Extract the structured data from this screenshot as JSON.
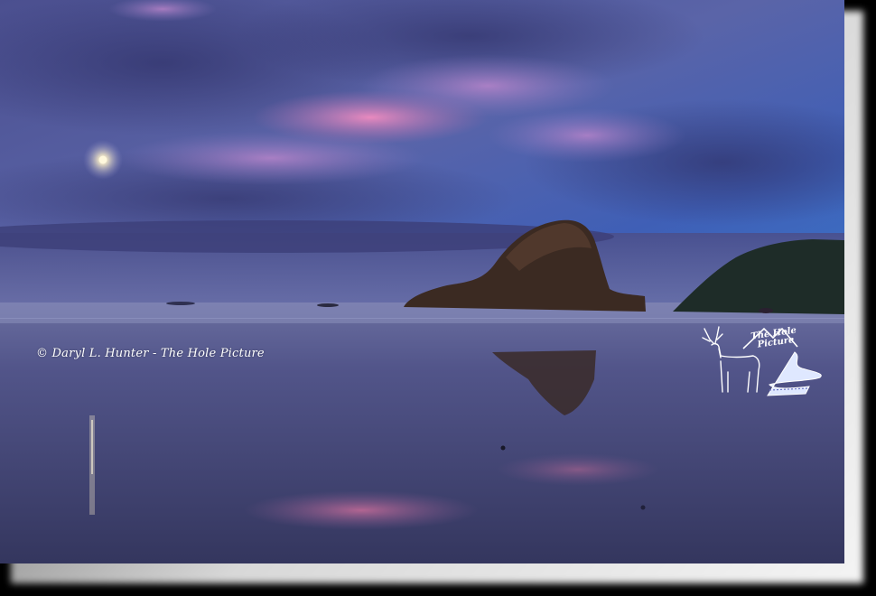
{
  "photo": {
    "subject": "sea-stack-at-dusk-with-moon",
    "colors": {
      "sky_top": "#3e55a8",
      "sky_pink": "#e77bb5",
      "clouds": "#5a5f9e",
      "sea": "#4a4e82",
      "beach": "#3e4170",
      "rock": "#3c2a22",
      "headland": "#1e2c26",
      "moon": "#fff6d8",
      "frame_shadow": "#d8d8d8"
    }
  },
  "watermark": {
    "text": "© Daryl L. Hunter - The Hole Picture"
  },
  "logo": {
    "text_line1": "The Hole",
    "text_line2": "Picture",
    "icon": "elk-mountain-river-logo-icon"
  }
}
